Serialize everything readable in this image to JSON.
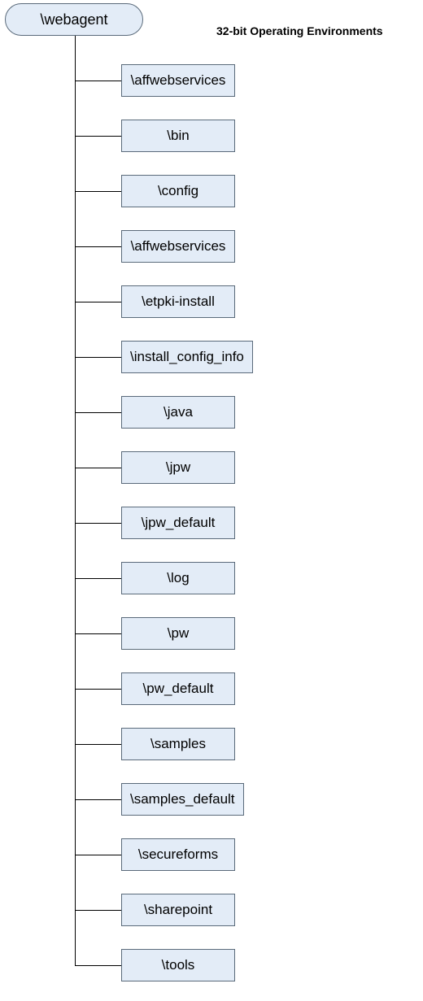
{
  "title": "32-bit Operating Environments",
  "root": {
    "label": "\\webagent"
  },
  "children": [
    {
      "label": "\\affwebservices"
    },
    {
      "label": "\\bin"
    },
    {
      "label": "\\config"
    },
    {
      "label": "\\affwebservices"
    },
    {
      "label": "\\etpki-install"
    },
    {
      "label": "\\install_config_info"
    },
    {
      "label": "\\java"
    },
    {
      "label": "\\jpw"
    },
    {
      "label": "\\jpw_default"
    },
    {
      "label": "\\log"
    },
    {
      "label": "\\pw"
    },
    {
      "label": "\\pw_default"
    },
    {
      "label": "\\samples"
    },
    {
      "label": "\\samples_default"
    },
    {
      "label": "\\secureforms"
    },
    {
      "label": "\\sharepoint"
    },
    {
      "label": "\\tools"
    }
  ],
  "layout": {
    "childStartTop": 35,
    "childSpacing": 68,
    "boxLeft": 57,
    "boxMinWidth": 140,
    "hlineLength": 57
  }
}
